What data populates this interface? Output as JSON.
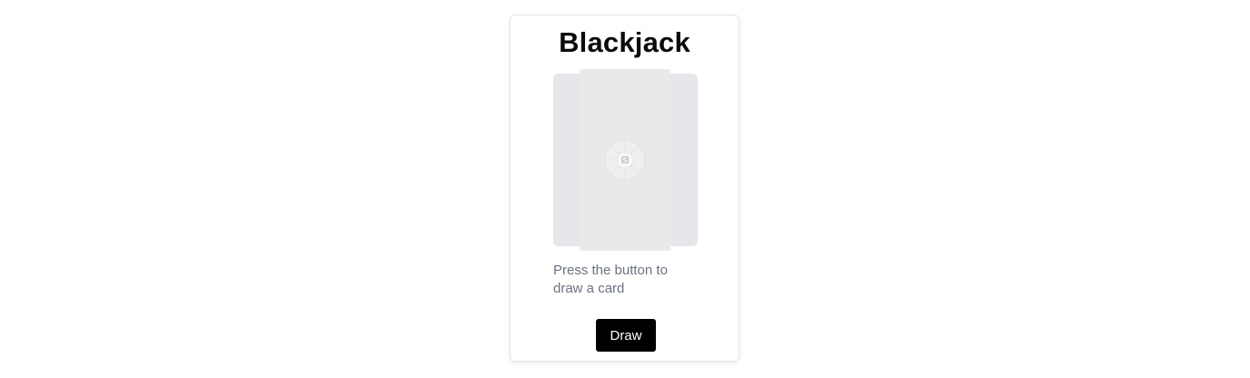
{
  "app": {
    "title": "Blackjack"
  },
  "card_area": {
    "icon": "image-placeholder-icon"
  },
  "status": {
    "message": "Press the button to draw a card"
  },
  "controls": {
    "draw_label": "Draw"
  },
  "colors": {
    "button_bg": "#000000",
    "button_text": "#ffffff",
    "card_back": "#e6e7ea",
    "card_front": "#e9e9ea",
    "muted_text": "#6b7280"
  }
}
